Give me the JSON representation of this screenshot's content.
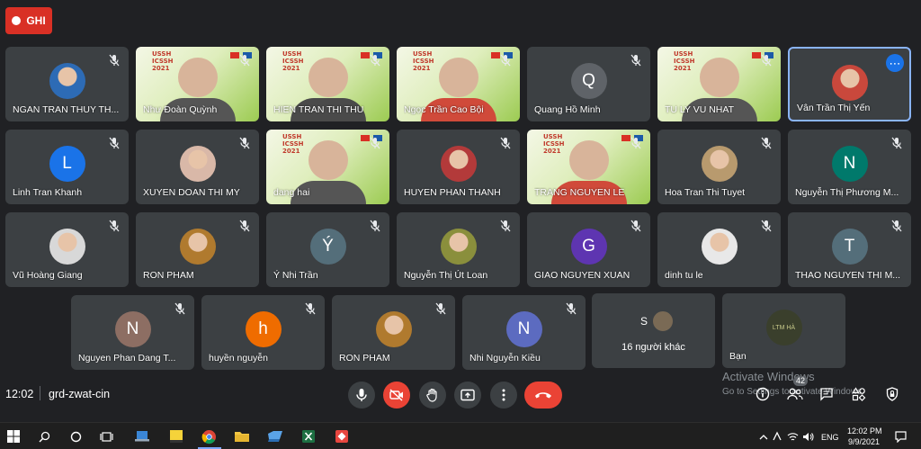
{
  "recording": {
    "label": "GHI"
  },
  "participants": [
    {
      "name": "NGAN TRAN THUY TH...",
      "type": "photo",
      "color": "#2d6bb5",
      "muted": true
    },
    {
      "name": "Như Đoàn Quỳnh",
      "type": "video",
      "muted": true,
      "logo": "USSH\nICSSH\n2021"
    },
    {
      "name": "HIEN TRAN THI THU",
      "type": "video",
      "muted": true,
      "logo": "USSH\nICSSH\n2021"
    },
    {
      "name": "Ngọc Trần Cao Bội",
      "type": "video",
      "muted": true,
      "logo": "USSH\nICSSH\n2021"
    },
    {
      "name": "Quang Hồ Minh",
      "type": "initial",
      "initial": "Q",
      "color": "#5f6368",
      "muted": true
    },
    {
      "name": "TU LY VU NHAT",
      "type": "video",
      "muted": true,
      "logo": "USSH\nICSSH\n2021"
    },
    {
      "name": "Vân Trần Thị Yến",
      "type": "photo",
      "color": "#c9483c",
      "muted": false,
      "active": true
    },
    {
      "name": "Linh Tran Khanh",
      "type": "initial",
      "initial": "L",
      "color": "#1a73e8",
      "muted": true
    },
    {
      "name": "XUYEN DOAN THI MY",
      "type": "photo",
      "color": "#d9b8a8",
      "muted": true
    },
    {
      "name": "dang hai",
      "type": "video",
      "muted": true,
      "logo": "USSH\nICSSH\n2021"
    },
    {
      "name": "HUYEN PHAN THANH",
      "type": "photo",
      "color": "#b33a3a",
      "muted": true
    },
    {
      "name": "TRANG NGUYEN LE",
      "type": "video",
      "muted": true,
      "logo": "USSH\nICSSH\n2021"
    },
    {
      "name": "Hoa Tran Thi Tuyet",
      "type": "photo",
      "color": "#b89a6e",
      "muted": true
    },
    {
      "name": "Nguyễn Thị Phương M...",
      "type": "initial",
      "initial": "N",
      "color": "#00796b",
      "muted": true
    },
    {
      "name": "Vũ Hoàng Giang",
      "type": "photo",
      "color": "#d8d8d8",
      "muted": true
    },
    {
      "name": "RON PHAM",
      "type": "photo",
      "color": "#b07a2e",
      "muted": true
    },
    {
      "name": "Ý Nhi Trần",
      "type": "initial",
      "initial": "Ý",
      "color": "#546e7a",
      "muted": true
    },
    {
      "name": "Nguyễn Thị Út Loan",
      "type": "photo",
      "color": "#8a8f3c",
      "muted": true
    },
    {
      "name": "GIAO NGUYEN XUAN",
      "type": "initial",
      "initial": "G",
      "color": "#5e35b1",
      "muted": true
    },
    {
      "name": "dinh tu le",
      "type": "photo",
      "color": "#e8e8e8",
      "muted": true
    },
    {
      "name": "THAO NGUYEN THI M...",
      "type": "initial",
      "initial": "T",
      "color": "#546e7a",
      "muted": true
    },
    {
      "name": "Nguyen Phan Dang T...",
      "type": "initial",
      "initial": "N",
      "color": "#8d6e63",
      "muted": true
    },
    {
      "name": "huyền nguyễn",
      "type": "initial",
      "initial": "h",
      "color": "#ef6c00",
      "muted": true
    },
    {
      "name": "RON PHAM",
      "type": "photo",
      "color": "#b07a2e",
      "muted": true
    },
    {
      "name": "Nhi Nguyễn Kiều",
      "type": "initial",
      "initial": "N",
      "color": "#5c6bc0",
      "muted": true
    }
  ],
  "others": {
    "label": "16 người khác",
    "initial": "S",
    "color": "#e91e63"
  },
  "self": {
    "name": "Bạn",
    "avatar_text": "LTM HÀ"
  },
  "meeting": {
    "time": "12:02",
    "code": "grd-zwat-cin",
    "participant_count": "42"
  },
  "watermark": {
    "title": "Activate Windows",
    "subtitle": "Go to Settings to activate Windows."
  },
  "taskbar": {
    "lang": "ENG",
    "time": "12:02 PM",
    "date": "9/9/2021"
  }
}
